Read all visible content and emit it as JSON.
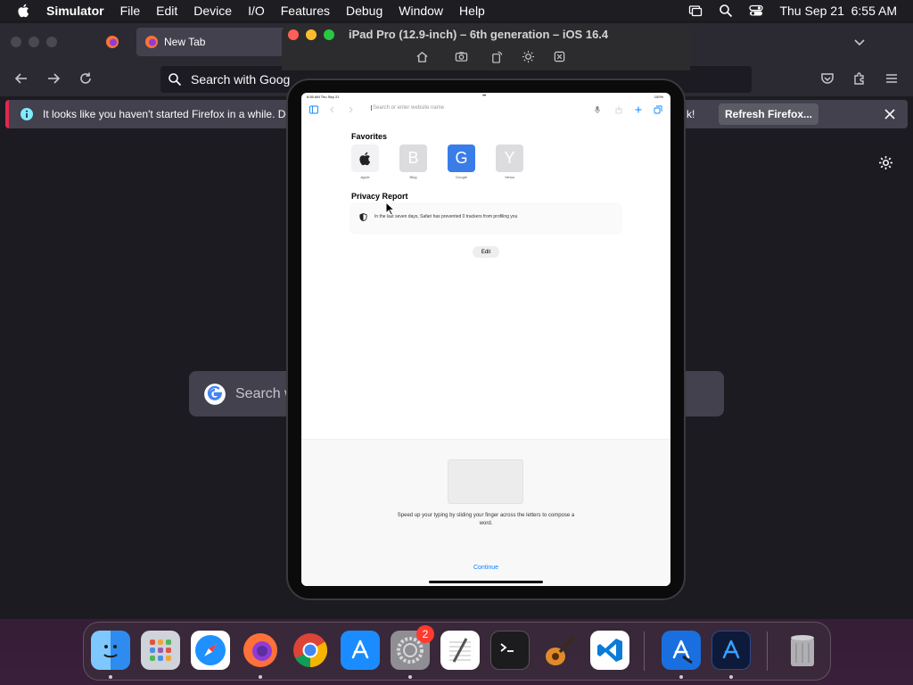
{
  "menubar": {
    "app": "Simulator",
    "items": [
      "File",
      "Edit",
      "Device",
      "I/O",
      "Features",
      "Debug",
      "Window",
      "Help"
    ],
    "clock": "Thu Sep 21  6:55 AM"
  },
  "firefox": {
    "tab_title": "New Tab",
    "url_placeholder": "Search with Google or enter address",
    "url_visible": "Search with Goog",
    "notice_text": "It looks like you haven't started Firefox in a while. Do",
    "notice_tail": "k!",
    "refresh_label": "Refresh Firefox...",
    "google_search_placeholder": "Search w"
  },
  "simulator": {
    "title": "iPad Pro (12.9-inch) – 6th generation – iOS 16.4",
    "tools": [
      "home-icon",
      "screenshot-icon",
      "rotate-icon",
      "appearance-icon",
      "keyboard-icon"
    ],
    "colors": {
      "red": "#ff5f57",
      "yellow": "#febc2e",
      "green": "#28c840"
    }
  },
  "ipad": {
    "status_time": "6:55 AM  Thu Sep 21",
    "status_battery": "100%",
    "address_placeholder": "Search or enter website name",
    "favorites_title": "Favorites",
    "favorites": [
      {
        "label": "Apple",
        "letter": "",
        "color": "#f2f2f4"
      },
      {
        "label": "Bing",
        "letter": "B",
        "color": "#dcdcdf"
      },
      {
        "label": "Google",
        "letter": "G",
        "color": "#3a7de8"
      },
      {
        "label": "Yahoo",
        "letter": "Y",
        "color": "#dcdcdf"
      }
    ],
    "privacy_title": "Privacy Report",
    "privacy_text": "In the last seven days, Safari has prevented 0 trackers from profiling you",
    "edit_label": "Edit",
    "keyboard_tip": "Speed up your typing by sliding your finger across the letters to compose a word.",
    "continue_label": "Continue"
  },
  "dock": {
    "apps": [
      "finder-icon",
      "launchpad-icon",
      "safari-icon",
      "firefox-icon",
      "chrome-icon",
      "app-store-icon",
      "system-settings-icon",
      "textedit-icon",
      "terminal-icon",
      "garageband-icon",
      "vscode-icon",
      "xcode-icon",
      "instruments-icon",
      "trash-icon"
    ],
    "settings_badge": "2"
  }
}
